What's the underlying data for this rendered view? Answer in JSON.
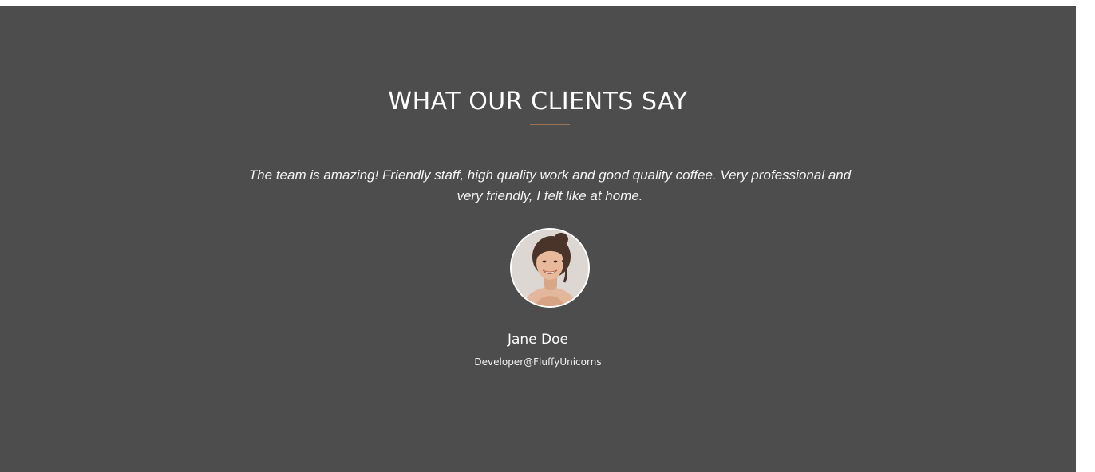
{
  "testimonials": {
    "title": "WHAT OUR CLIENTS SAY",
    "quote": "The team is amazing! Friendly staff, high quality work and good quality coffee. Very professional and very friendly, I felt like at home.",
    "author": {
      "name": "Jane Doe",
      "role": "Developer@FluffyUnicorns"
    }
  },
  "colors": {
    "section_background": "#4d4d4d",
    "accent_divider": "#a0724f",
    "text": "#ffffff"
  },
  "icons": {
    "avatar": "client-photo"
  }
}
